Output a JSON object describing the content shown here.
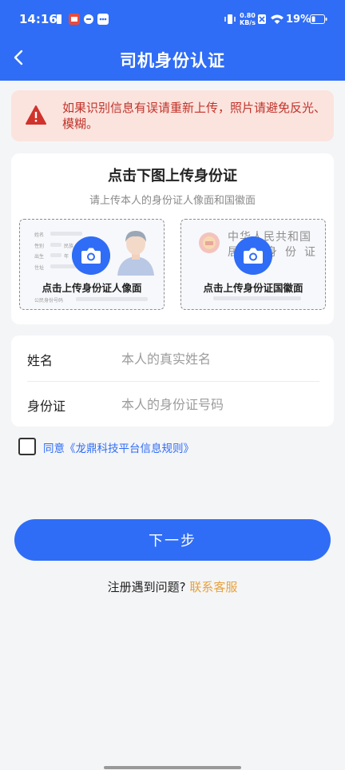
{
  "status_bar": {
    "time": "14:16",
    "net_speed_value": "0.80",
    "net_speed_unit": "KB/s",
    "battery": "19%"
  },
  "nav": {
    "back_icon": "back-arrow-icon",
    "title": "司机身份认证"
  },
  "warning": {
    "icon": "warning-icon",
    "text": "如果识别信息有误请重新上传，照片请避免反光、模糊。"
  },
  "upload": {
    "title": "点击下图上传身份证",
    "subtitle": "请上传本人的身份证人像面和国徽面",
    "front_label": "点击上传身份证人像面",
    "back_label": "点击上传身份证国徽面",
    "front_sample": {
      "name": "姓名",
      "gender": "性别",
      "ethnicity": "民族",
      "birth": "出生",
      "year": "年",
      "address": "住址",
      "id_number": "公民身份号码"
    },
    "back_sample": {
      "line1": "中华人民共和国",
      "line2": "居民身份证"
    },
    "camera_icon": "camera-icon"
  },
  "form": {
    "name_label": "姓名",
    "name_placeholder": "本人的真实姓名",
    "id_label": "身份证",
    "id_placeholder": "本人的身份证号码"
  },
  "agreement": {
    "text": "同意《龙鼎科技平台信息规则》",
    "checked": false
  },
  "next_button": "下一步",
  "help": {
    "prefix": "注册遇到问题?",
    "link": "联系客服"
  },
  "colors": {
    "primary": "#2f6df6",
    "warning_bg": "#fbe4de",
    "warning_text": "#c0332b",
    "link_orange": "#e8a23d"
  }
}
